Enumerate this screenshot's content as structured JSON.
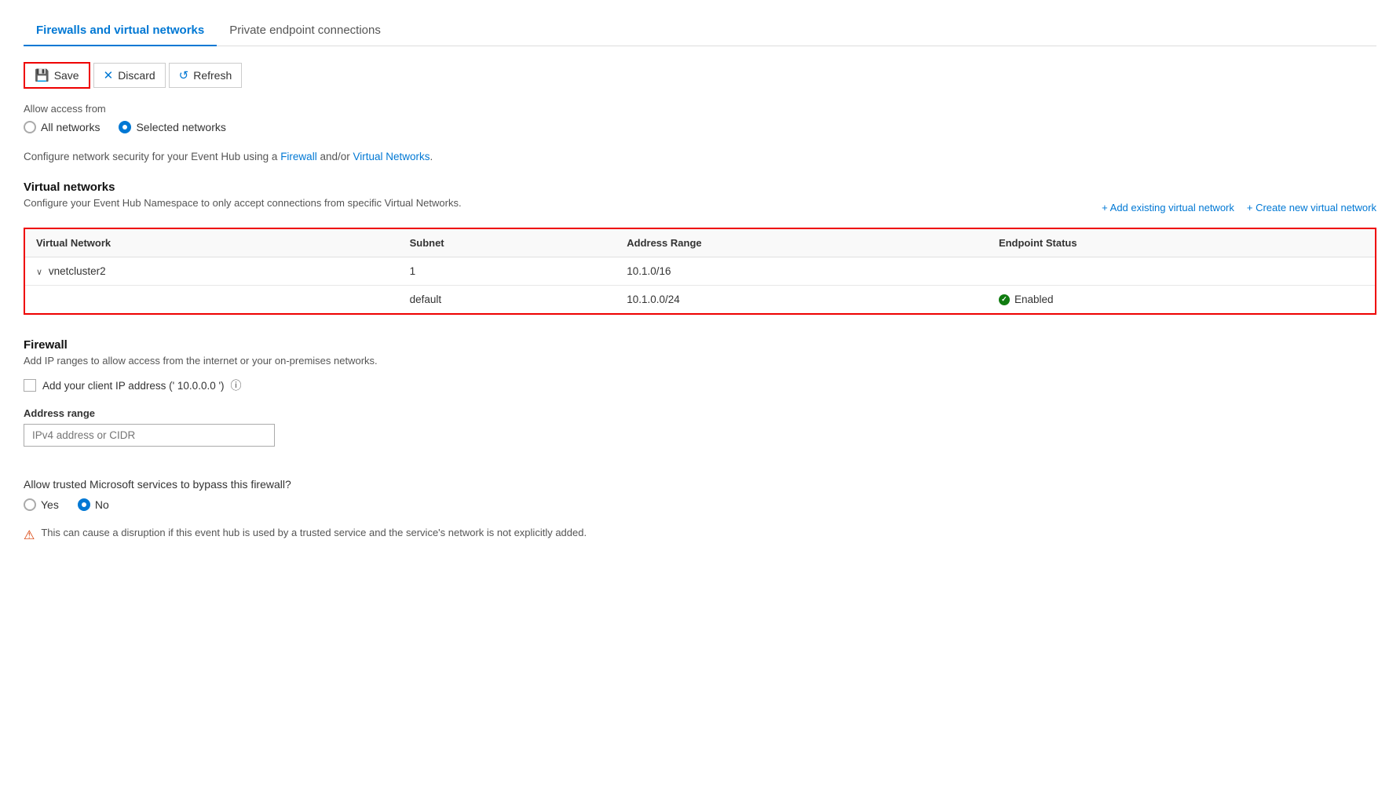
{
  "tabs": [
    {
      "id": "firewalls",
      "label": "Firewalls and virtual networks",
      "active": true
    },
    {
      "id": "private",
      "label": "Private endpoint connections",
      "active": false
    }
  ],
  "toolbar": {
    "save_label": "Save",
    "discard_label": "Discard",
    "refresh_label": "Refresh"
  },
  "access": {
    "label": "Allow access from",
    "options": [
      {
        "id": "all",
        "label": "All networks",
        "selected": false
      },
      {
        "id": "selected",
        "label": "Selected networks",
        "selected": true
      }
    ]
  },
  "configure_desc": "Configure network security for your Event Hub using a",
  "firewall_link": "Firewall",
  "andor_text": "and/or",
  "vn_link": "Virtual Networks",
  "configure_desc_end": ".",
  "virtual_networks": {
    "title": "Virtual networks",
    "description": "Configure your Event Hub Namespace to only accept connections from specific Virtual Networks.",
    "add_existing": "+ Add existing virtual network",
    "create_new": "+ Create new virtual network",
    "table": {
      "columns": [
        "Virtual Network",
        "Subnet",
        "Address Range",
        "Endpoint Status"
      ],
      "rows": [
        {
          "network": "vnetcluster2",
          "subnet": "1",
          "address_range": "10.1.0/16",
          "status": "",
          "has_children": true
        },
        {
          "network": "",
          "subnet": "default",
          "address_range": "10.1.0.0/24",
          "status": "Enabled",
          "has_children": false,
          "is_child": true
        }
      ]
    }
  },
  "firewall": {
    "title": "Firewall",
    "description": "Add IP ranges to allow access from the internet or your on-premises networks.",
    "client_ip_label": "Add your client IP address (' 10.0.0.0 ')",
    "address_range_label": "Address range",
    "address_placeholder": "IPv4 address or CIDR"
  },
  "trusted": {
    "question": "Allow trusted Microsoft services to bypass this firewall?",
    "options": [
      {
        "id": "yes",
        "label": "Yes",
        "selected": false
      },
      {
        "id": "no",
        "label": "No",
        "selected": true
      }
    ],
    "warning": "This can cause a disruption if this event hub is used by a trusted service and the service's network is not explicitly added."
  }
}
